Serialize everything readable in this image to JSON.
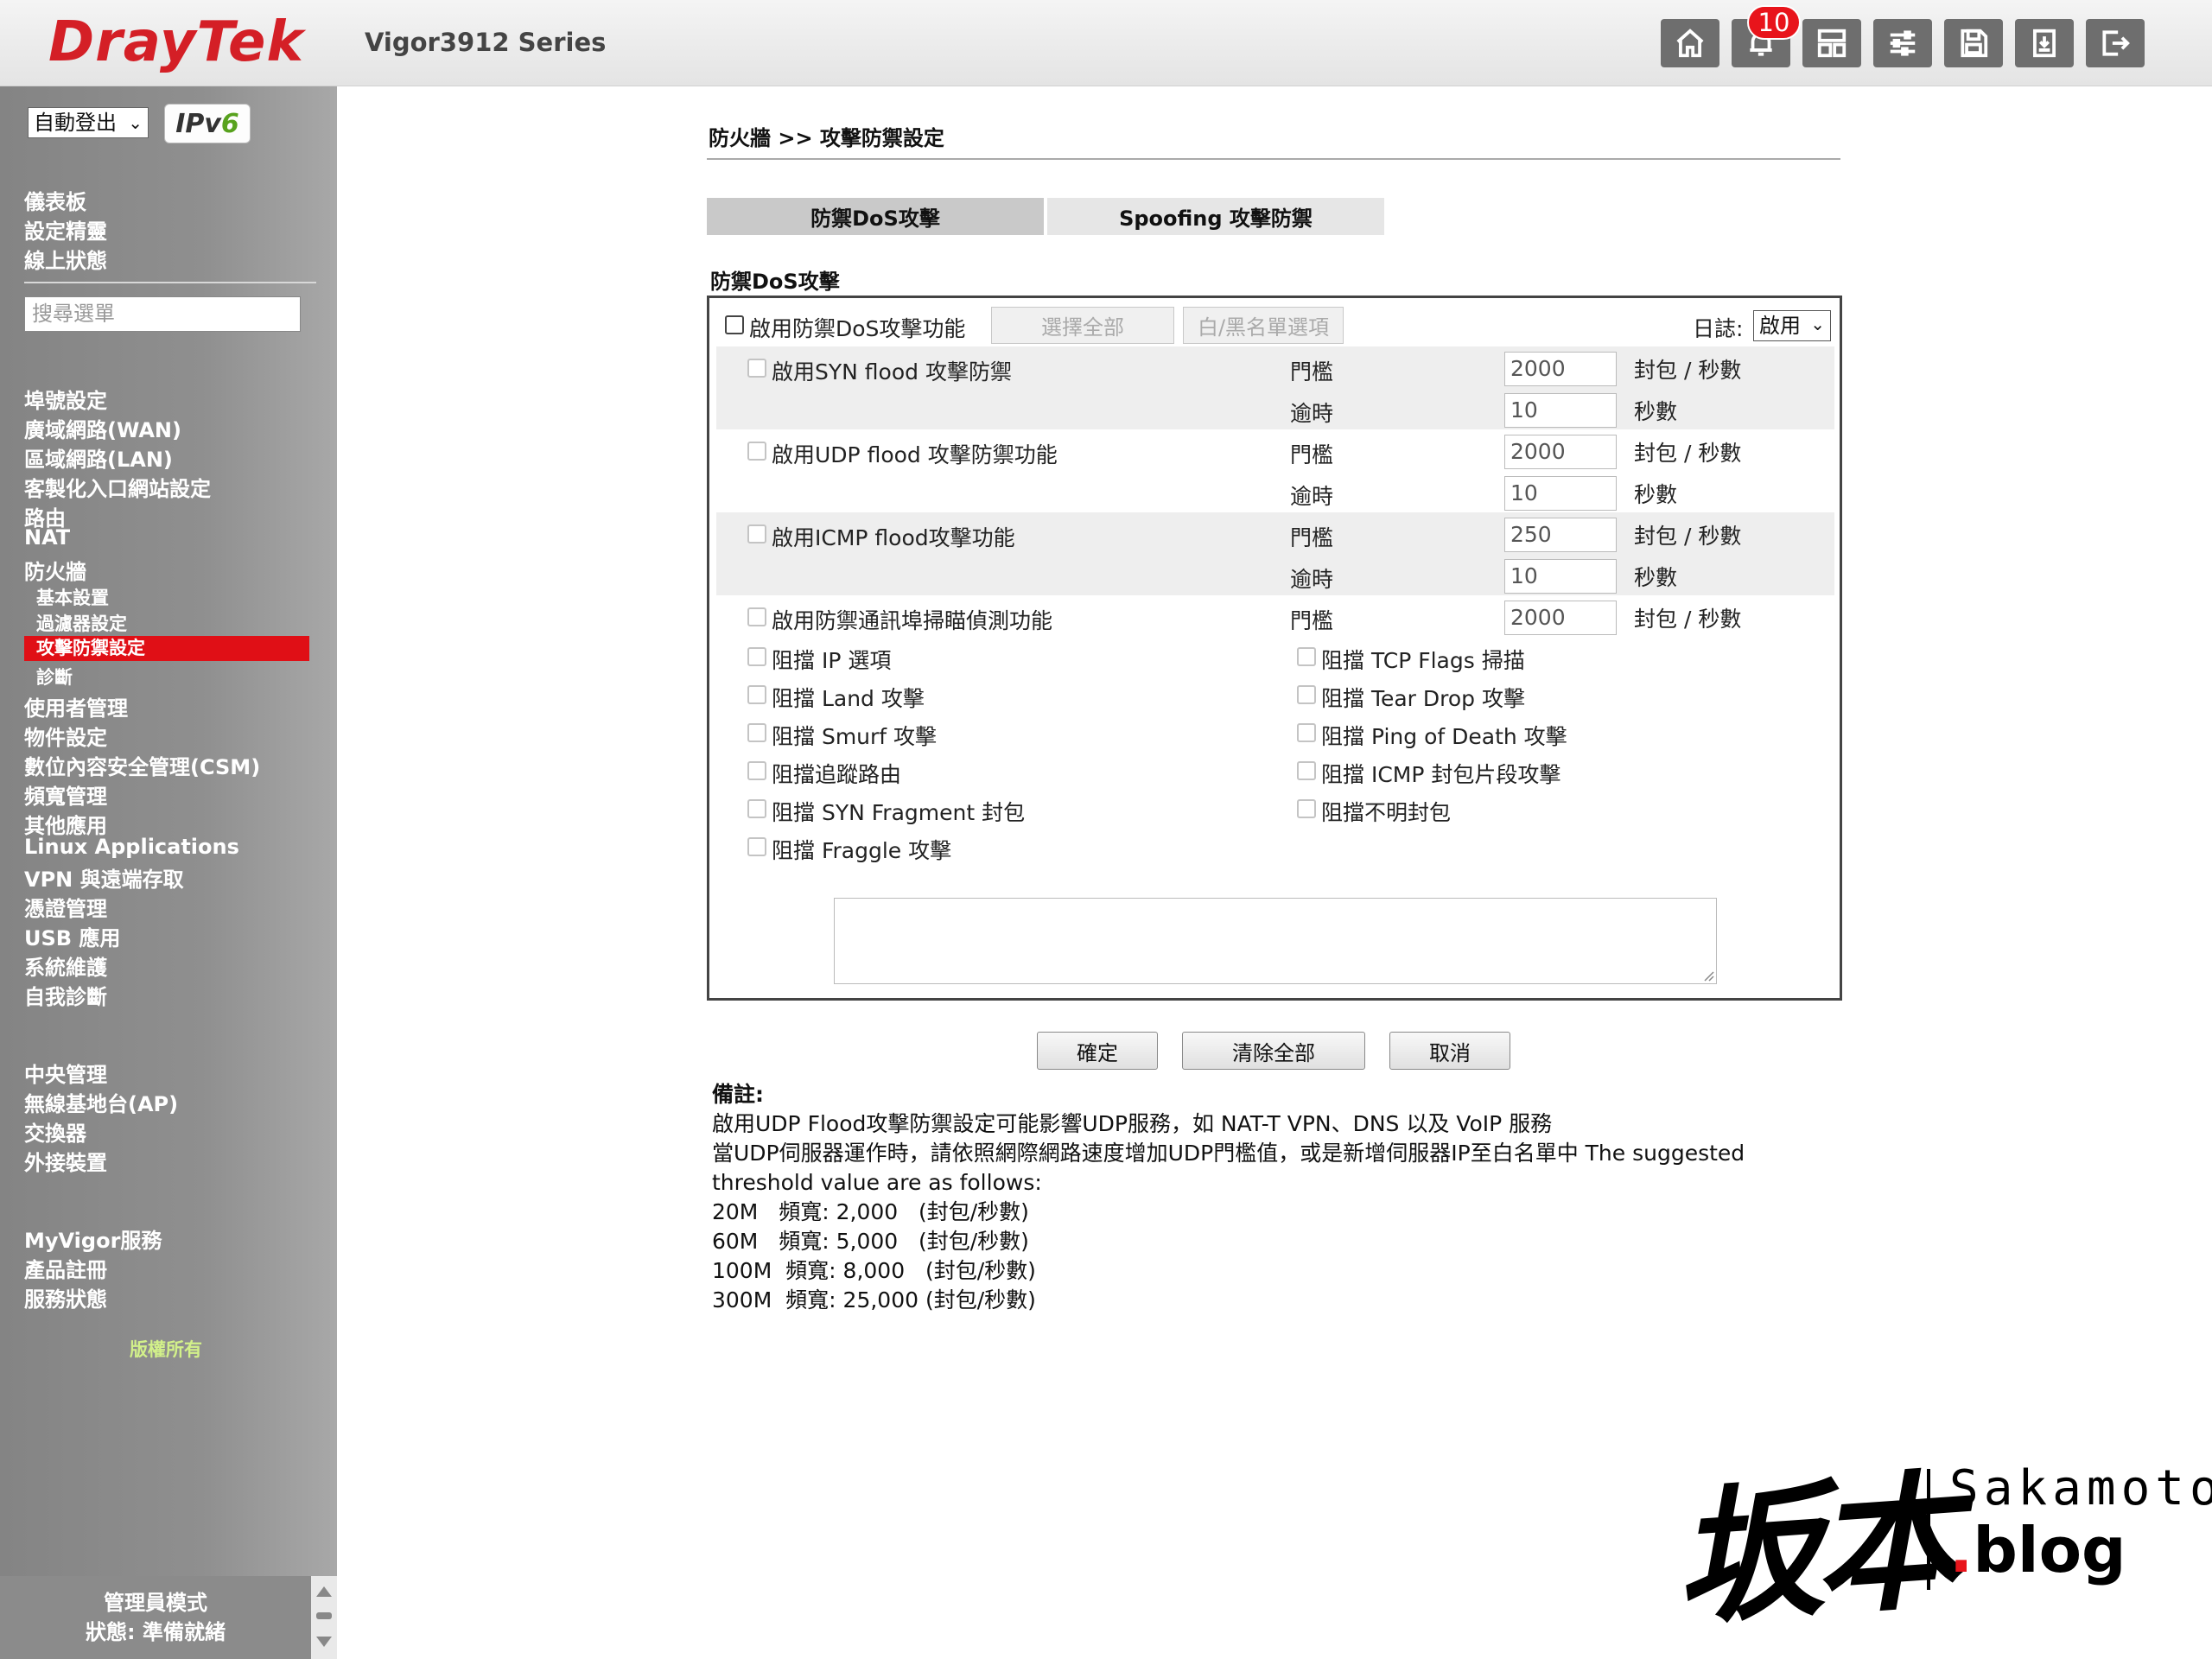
{
  "header": {
    "logo_a": "Dray",
    "logo_b": "Tek",
    "model": "Vigor3912 Series",
    "notification_count": "10",
    "icons": [
      "home-icon",
      "bell-icon",
      "layout-icon",
      "sliders-icon",
      "save-icon",
      "backup-icon",
      "logout-icon"
    ]
  },
  "sidebar": {
    "logout_select": "自動登出",
    "ipv6_a": "IPv",
    "ipv6_b": "6",
    "top_items": [
      "儀表板",
      "設定精靈",
      "線上狀態"
    ],
    "search_placeholder": "搜尋選單",
    "items": [
      "埠號設定",
      "廣域網路(WAN)",
      "區域網路(LAN)",
      "客製化入口網站設定",
      "路由",
      "NAT",
      "防火牆"
    ],
    "firewall_sub": [
      "基本設置",
      "過濾器設定",
      "攻擊防禦設定",
      "診斷"
    ],
    "items2": [
      "使用者管理",
      "物件設定",
      "數位內容安全管理(CSM)",
      "頻寬管理",
      "其他應用",
      "Linux Applications",
      "VPN 與遠端存取",
      "憑證管理",
      "USB 應用",
      "系統維護",
      "自我診斷"
    ],
    "central": [
      "中央管理",
      "無線基地台(AP)",
      "交換器",
      "外接裝置"
    ],
    "myvigor": [
      "MyVigor服務",
      "產品註冊",
      "服務狀態"
    ],
    "copyright": "版權所有",
    "status": {
      "mode": "管理員模式",
      "state": "狀態: 準備就緒"
    }
  },
  "main": {
    "breadcrumb": "防火牆 >> 攻擊防禦設定",
    "tabs": [
      "防禦DoS攻擊",
      "Spoofing 攻擊防禦"
    ],
    "section_title": "防禦DoS攻擊",
    "enable_label": "啟用防禦DoS攻擊功能",
    "select_all": "選擇全部",
    "whitelist": "白/黑名單選項",
    "log_label": "日誌:",
    "log_value": "啟用",
    "floods": [
      {
        "label": "啟用SYN flood 攻擊防禦",
        "threshold_label": "門檻",
        "threshold": "2000",
        "unit1": "封包 / 秒數",
        "timeout_label": "逾時",
        "timeout": "10",
        "unit2": "秒數"
      },
      {
        "label": "啟用UDP flood 攻擊防禦功能",
        "threshold_label": "門檻",
        "threshold": "2000",
        "unit1": "封包 / 秒數",
        "timeout_label": "逾時",
        "timeout": "10",
        "unit2": "秒數"
      },
      {
        "label": "啟用ICMP flood攻擊功能",
        "threshold_label": "門檻",
        "threshold": "250",
        "unit1": "封包 / 秒數",
        "timeout_label": "逾時",
        "timeout": "10",
        "unit2": "秒數"
      }
    ],
    "portscan": {
      "label": "啟用防禦通訊埠掃瞄偵測功能",
      "threshold_label": "門檻",
      "threshold": "2000",
      "unit": "封包 / 秒數"
    },
    "blocks_left": [
      "阻擋 IP 選項",
      "阻擋 Land 攻擊",
      "阻擋 Smurf 攻擊",
      "阻擋追蹤路由",
      "阻擋 SYN Fragment 封包",
      "阻擋 Fraggle 攻擊"
    ],
    "blocks_right": [
      "阻擋 TCP Flags 掃描",
      "阻擋 Tear Drop 攻擊",
      "阻擋 Ping of Death 攻擊",
      "阻擋 ICMP 封包片段攻擊",
      "阻擋不明封包"
    ],
    "buttons": {
      "ok": "確定",
      "clear": "清除全部",
      "cancel": "取消"
    },
    "notes": {
      "title": "備註:",
      "lines": [
        "啟用UDP Flood攻擊防禦設定可能影響UDP服務，如 NAT-T VPN、DNS 以及 VoIP 服務",
        "當UDP伺服器運作時，請依照網際網路速度增加UDP門檻值，或是新增伺服器IP至白名單中  The suggested",
        "threshold value are as follows:",
        "20M   頻寬: 2,000   (封包/秒數)",
        "60M   頻寬: 5,000   (封包/秒數)",
        "100M  頻寬: 8,000   (封包/秒數)",
        "300M  頻寬: 25,000 (封包/秒數)"
      ]
    }
  },
  "watermark": {
    "kanji": "坂本",
    "brand": "Sakamoto",
    "blog_dot": ".",
    "blog": "blog"
  }
}
